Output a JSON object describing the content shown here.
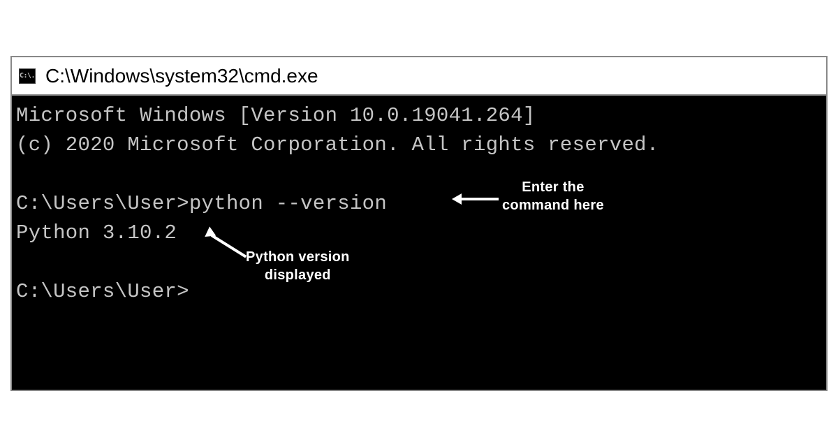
{
  "window": {
    "icon_text": "C:\\.",
    "title": "C:\\Windows\\system32\\cmd.exe"
  },
  "terminal": {
    "line1": "Microsoft Windows [Version 10.0.19041.264]",
    "line2": "(c) 2020 Microsoft Corporation. All rights reserved.",
    "prompt1": "C:\\Users\\User>",
    "command": "python --version",
    "output": "Python 3.10.2",
    "prompt2": "C:\\Users\\User>"
  },
  "annotations": {
    "command_label_line1": "Enter the",
    "command_label_line2": "command here",
    "version_label_line1": "Python version",
    "version_label_line2": "displayed"
  }
}
